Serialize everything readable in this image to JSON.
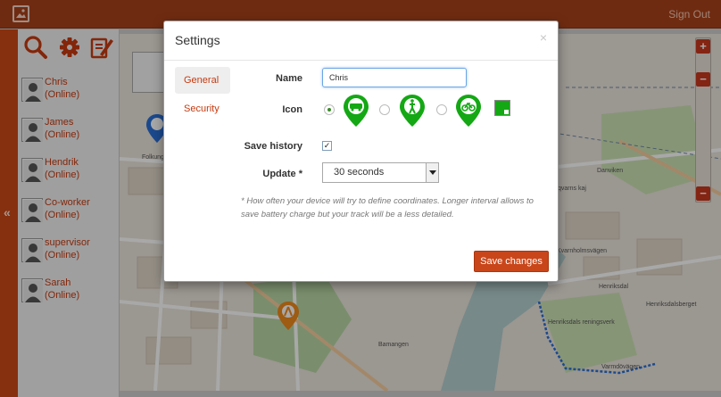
{
  "header": {
    "signout_label": "Sign Out"
  },
  "sidebar": {
    "users": [
      {
        "name": "Chris",
        "status": "(Online)"
      },
      {
        "name": "James",
        "status": "(Online)"
      },
      {
        "name": "Hendrik",
        "status": "(Online)"
      },
      {
        "name": "Co-worker",
        "status": "(Online)"
      },
      {
        "name": "supervisor",
        "status": "(Online)"
      },
      {
        "name": "Sarah",
        "status": "(Online)"
      }
    ],
    "toggle_label": "«"
  },
  "map": {
    "labels": [
      "Danviken",
      "Henriksdal",
      "Henriksdalsberget",
      "Bamangen",
      "Varmdövägen",
      "Kvarnholmsvägen",
      "Henriksdals reningsverk",
      "Folkungagatan",
      "Saltsjöqvarns kaj"
    ]
  },
  "settings": {
    "title": "Settings",
    "close_label": "×",
    "nav": {
      "general": "General",
      "security": "Security"
    },
    "name_label": "Name",
    "name_value": "Chris",
    "icon_label": "Icon",
    "icon_options": [
      "car-marker-icon",
      "walk-marker-icon",
      "bike-marker-icon"
    ],
    "icon_selected": 0,
    "icon_color": "#14a814",
    "save_history_label": "Save history",
    "save_history_checked": "✓",
    "update_label": "Update *",
    "update_value": "30 seconds",
    "hint": "* How often your device will try to define coordinates. Longer interval allows to save battery charge but your track will be a less detailed.",
    "save_label": "Save changes"
  },
  "colors": {
    "accent": "#cc4a18",
    "topbar": "#a9421a",
    "marker_green": "#14a814"
  }
}
